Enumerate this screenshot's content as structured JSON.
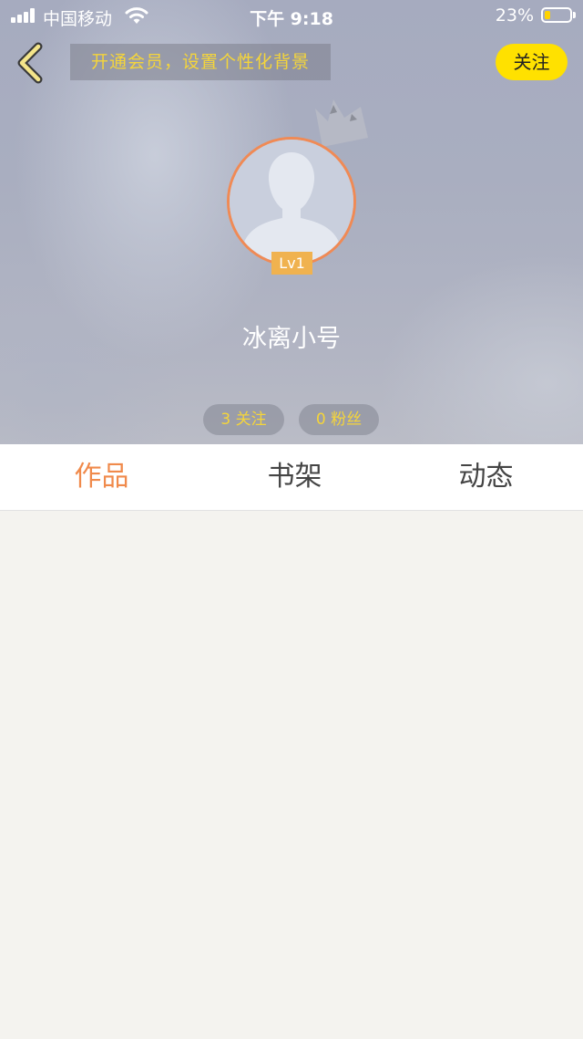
{
  "status_bar": {
    "carrier": "中国移动",
    "time": "下午 9:18",
    "battery_percent": "23%",
    "battery_level": 0.23
  },
  "nav": {
    "promo_text": "开通会员，设置个性化背景",
    "follow_label": "关注"
  },
  "profile": {
    "level": "Lv1",
    "username": "冰离小号",
    "following": "3 关注",
    "fans": "0 粉丝"
  },
  "tabs": [
    {
      "label": "作品",
      "active": true
    },
    {
      "label": "书架",
      "active": false
    },
    {
      "label": "动态",
      "active": false
    }
  ],
  "colors": {
    "accent_orange": "#f08a4b",
    "accent_yellow": "#ffe100",
    "promo_text": "#f5d53a"
  }
}
